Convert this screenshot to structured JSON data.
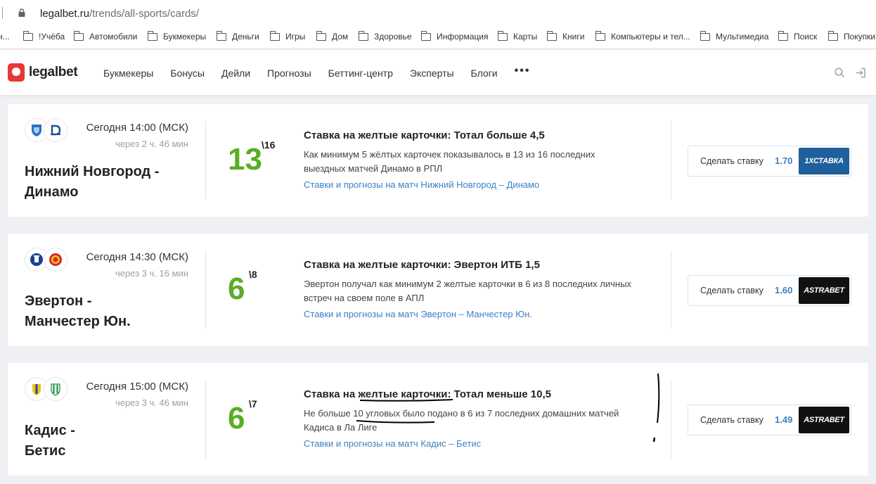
{
  "browser": {
    "url_host": "legalbet.ru",
    "url_path": "/trends/all-sports/cards/"
  },
  "bookmarks": [
    {
      "label": "н..."
    },
    {
      "label": "!Учёба"
    },
    {
      "label": "Автомобили"
    },
    {
      "label": "Букмекеры"
    },
    {
      "label": "Деньги"
    },
    {
      "label": "Игры"
    },
    {
      "label": "Дом"
    },
    {
      "label": "Здоровье"
    },
    {
      "label": "Информация"
    },
    {
      "label": "Карты"
    },
    {
      "label": "Книги"
    },
    {
      "label": "Компьютеры и тел..."
    },
    {
      "label": "Мультимедиа"
    },
    {
      "label": "Поиск"
    },
    {
      "label": "Покупки"
    }
  ],
  "site": {
    "logo": "legalbet",
    "nav": [
      "Букмекеры",
      "Бонусы",
      "Дейли",
      "Прогнозы",
      "Беттинг-центр",
      "Эксперты",
      "Блоги"
    ],
    "more": "•••"
  },
  "cards": [
    {
      "date": "Сегодня 14:00 (МСК)",
      "countdown": "через 2 ч. 46 мин",
      "match_line1": "Нижний Новгород -",
      "match_line2": "Динамо",
      "hits": "13",
      "total": "\\16",
      "bet_title": "Ставка на желтые карточки: Тотал больше 4,5",
      "bet_desc": "Как минимум 5 жёлтых карточек показывалось в 13 из 16 последних выездных матчей Динамо в РПЛ",
      "bet_link": "Ставки и прогнозы на матч Нижний Новгород – Динамо",
      "button_label": "Сделать ставку",
      "odds": "1.70",
      "bookmaker": "1ХСТАВКА",
      "bookmaker_color": "#1f5f9c"
    },
    {
      "date": "Сегодня 14:30 (МСК)",
      "countdown": "через 3 ч. 16 мин",
      "match_line1": "Эвертон -",
      "match_line2": "Манчестер Юн.",
      "hits": "6",
      "total": "\\8",
      "bet_title": "Ставка на желтые карточки: Эвертон ИТБ 1,5",
      "bet_desc": "Эвертон получал как минимум 2 желтые карточки в 6 из 8 последних личных встреч на своем поле в АПЛ",
      "bet_link": "Ставки и прогнозы на матч Эвертон – Манчестер Юн.",
      "button_label": "Сделать ставку",
      "odds": "1.60",
      "bookmaker": "ASTRABET",
      "bookmaker_color": "#111111"
    },
    {
      "date": "Сегодня 15:00 (МСК)",
      "countdown": "через 3 ч. 46 мин",
      "match_line1": "Кадис -",
      "match_line2": "Бетис",
      "hits": "6",
      "total": "\\7",
      "bet_title": "Ставка на желтые карточки: Тотал меньше 10,5",
      "bet_desc": "Не больше 10 угловых было подано в 6 из 7 последних домашних матчей Кадиса в Ла Лиге",
      "bet_link": "Ставки и прогнозы на матч Кадис – Бетис",
      "button_label": "Сделать ставку",
      "odds": "1.49",
      "bookmaker": "ASTRABET",
      "bookmaker_color": "#111111"
    }
  ],
  "colors": {
    "accent_green": "#5aad25",
    "link_blue": "#3b82c4",
    "logo_red": "#e53935"
  }
}
